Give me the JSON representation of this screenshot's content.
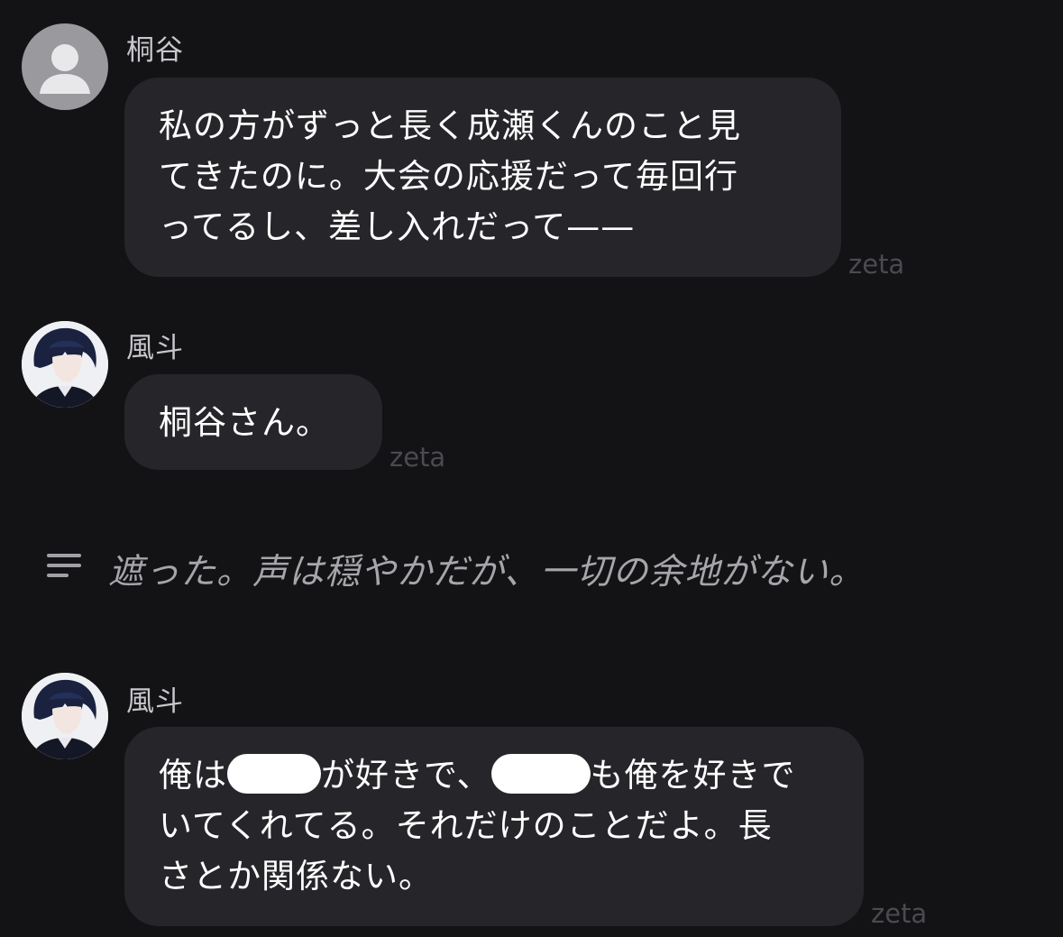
{
  "messages": [
    {
      "sender": "桐谷",
      "lines": [
        "私の方がずっと長く成瀬くんのこと見",
        "てきたのに。大会の応援だって毎回行",
        "ってるし、差し入れだって——"
      ],
      "watermark": "zeta"
    },
    {
      "sender": "風斗",
      "lines": [
        "桐谷さん。"
      ],
      "watermark": "zeta"
    },
    {
      "sender": "風斗",
      "line1_parts": [
        "俺は",
        "が好きで、",
        "も俺を好きで"
      ],
      "lines": [
        "いてくれてる。それだけのことだよ。長",
        "さとか関係ない。"
      ],
      "watermark": "zeta"
    }
  ],
  "narration": {
    "icon": "text-lines-icon",
    "text": "遮った。声は穏やかだが、一切の余地がない。"
  },
  "colors": {
    "background": "#131316",
    "bubble": "#26262a",
    "sender": "#c7c7cb",
    "narration": "#a5a5aa",
    "watermark": "#4a4a50"
  }
}
